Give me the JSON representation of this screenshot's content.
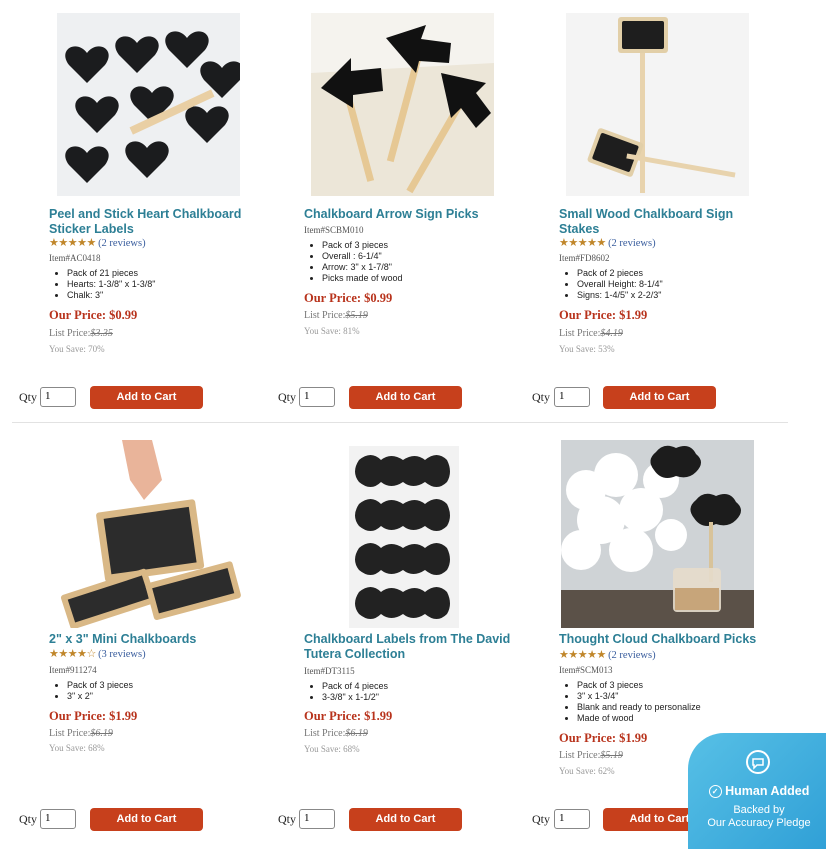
{
  "products": [
    {
      "title": "Peel and Stick Heart Chalkboard Sticker Labels",
      "stars": "★★★★★",
      "reviews": "(2 reviews)",
      "item": "Item#AC0418",
      "bullets": [
        "Pack of 21 pieces",
        "Hearts: 1-3/8\" x 1-3/8\"",
        "Chalk: 3\""
      ],
      "price_label": "Our Price:",
      "price": "$0.99",
      "list_label": "List Price:",
      "list": "$3.35",
      "save": "You Save: 70%",
      "qty_label": "Qty",
      "qty": "1",
      "button": "Add to Cart",
      "image": "heart-chalkboard-stickers"
    },
    {
      "title": "Chalkboard Arrow Sign Picks",
      "stars": "",
      "reviews": "",
      "item": "Item#SCBM010",
      "bullets": [
        "Pack of 3 pieces",
        "Overall : 6-1/4\"",
        "Arrow: 3\" x 1-7/8\"",
        "Picks made of wood"
      ],
      "price_label": "Our Price:",
      "price": "$0.99",
      "list_label": "List Price:",
      "list": "$5.19",
      "save": "You Save: 81%",
      "qty_label": "Qty",
      "qty": "1",
      "button": "Add to Cart",
      "image": "arrow-sign-picks"
    },
    {
      "title": "Small Wood Chalkboard Sign Stakes",
      "stars": "★★★★★",
      "reviews": "(2 reviews)",
      "item": "Item#FD8602",
      "bullets": [
        "Pack of 2 pieces",
        "Overall Height: 8-1/4\"",
        "Signs: 1-4/5\" x 2-2/3\""
      ],
      "price_label": "Our Price:",
      "price": "$1.99",
      "list_label": "List Price:",
      "list": "$4.19",
      "save": "You Save: 53%",
      "qty_label": "Qty",
      "qty": "1",
      "button": "Add to Cart",
      "image": "wood-sign-stakes"
    },
    {
      "title": "2\" x 3\" Mini Chalkboards",
      "stars": "★★★★☆",
      "reviews": "(3 reviews)",
      "item": "Item#911274",
      "bullets": [
        "Pack of 3 pieces",
        "3\" x 2\""
      ],
      "price_label": "Our Price:",
      "price": "$1.99",
      "list_label": "List Price:",
      "list": "$6.19",
      "save": "You Save: 68%",
      "qty_label": "Qty",
      "qty": "1",
      "button": "Add to Cart",
      "image": "mini-chalkboards"
    },
    {
      "title": "Chalkboard Labels from The David Tutera Collection",
      "stars": "",
      "reviews": "",
      "item": "Item#DT3115",
      "bullets": [
        "Pack of 4 pieces",
        "3-3/8\" x 1-1/2\""
      ],
      "price_label": "Our Price:",
      "price": "$1.99",
      "list_label": "List Price:",
      "list": "$6.19",
      "save": "You Save: 68%",
      "qty_label": "Qty",
      "qty": "1",
      "button": "Add to Cart",
      "image": "david-tutera-labels"
    },
    {
      "title": "Thought Cloud Chalkboard Picks",
      "stars": "★★★★★",
      "reviews": "(2 reviews)",
      "item": "Item#SCM013",
      "bullets": [
        "Pack of 3 pieces",
        "3\" x 1-3/4\"",
        "Blank and ready to personalize",
        "Made of wood"
      ],
      "price_label": "Our Price:",
      "price": "$1.99",
      "list_label": "List Price:",
      "list": "$5.19",
      "save": "You Save: 62%",
      "qty_label": "Qty",
      "qty": "1",
      "button": "Add to Cart",
      "image": "thought-cloud-picks"
    }
  ],
  "badge": {
    "title": "Human Added",
    "line1": "Backed by",
    "line2": "Our Accuracy Pledge"
  },
  "colors": {
    "title": "#2d7f95",
    "price": "#b8331c",
    "button": "#c7401c",
    "badge": "#3fb0e0"
  }
}
